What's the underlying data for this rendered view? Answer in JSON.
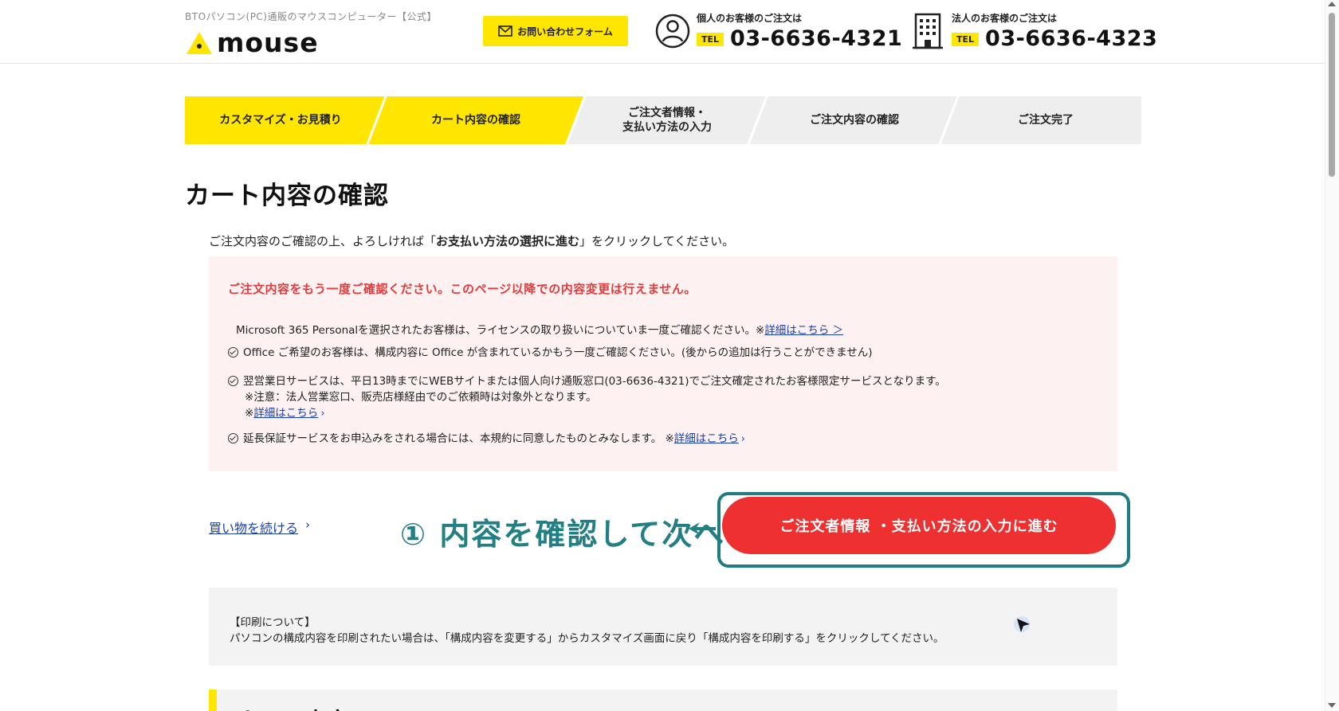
{
  "header": {
    "tagline": "BTOパソコン(PC)通販のマウスコンピューター【公式】",
    "logo_text": "mouse",
    "contact_button": "お問い合わせフォーム",
    "personal": {
      "label": "個人のお客様のご注文は",
      "tel_badge": "TEL",
      "number": "03-6636-4321"
    },
    "business": {
      "label": "法人のお客様のご注文は",
      "tel_badge": "TEL",
      "number": "03-6636-4323"
    },
    "accent_color": "#ffe600"
  },
  "steps": [
    {
      "label": "カスタマイズ・お見積り",
      "state": "done"
    },
    {
      "label": "カート内容の確認",
      "state": "current"
    },
    {
      "label_line1": "ご注文者情報・",
      "label_line2": "支払い方法の入力",
      "state": "todo"
    },
    {
      "label": "ご注文内容の確認",
      "state": "todo"
    },
    {
      "label": "ご注文完了",
      "state": "todo"
    }
  ],
  "page_title": "カート内容の確認",
  "intro": {
    "before": "ご注文内容のご確認の上、よろしければ「",
    "bold": "お支払い方法の選択に進む",
    "after": "」をクリックしてください。"
  },
  "notice": {
    "headline": "ご注文内容をもう一度ご確認ください。このページ以降での内容変更は行えません。",
    "ms365": {
      "text": "Microsoft 365 Personalを選択されたお客様は、ライセンスの取り扱いについていま一度ご確認ください。※",
      "link": "詳細はこちら ＞"
    },
    "office": "Office ご希望のお客様は、構成内容に Office が含まれているかもう一度ご確認ください。(後からの追加は行うことができません)",
    "nextday": {
      "line1": "翌営業日サービスは、平日13時までにWEBサイトまたは個人向け通販窓口(03-6636-4321)でご注文確定されたお客様限定サービスとなります。",
      "line2": "※注意：法人営業窓口、販売店様経由でのご依頼時は対象外となります。",
      "prefix": "※",
      "link": "詳細はこちら"
    },
    "warranty": {
      "text": "延長保証サービスをお申込みをされる場合には、本規約に同意したものとみなします。 ※",
      "link": "詳細はこちら"
    },
    "bg_color": "#fdf1f1",
    "headline_color": "#e03c3c"
  },
  "continue_shopping": "買い物を続ける",
  "annotation": {
    "text": "① 内容を確認して次へ",
    "color": "#227f84"
  },
  "next_button": {
    "label": "ご注文者情報 ・支払い方法の入力に進む",
    "color": "#ee3030"
  },
  "print": {
    "title": "【印刷について】",
    "text": "パソコンの構成内容を印刷されたい場合は、「構成内容を変更する」からカスタマイズ画面に戻り「構成内容を印刷する」をクリックしてください。"
  },
  "section2_peek": "カート内容"
}
